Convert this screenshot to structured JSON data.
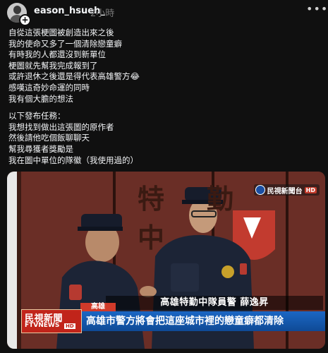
{
  "post": {
    "username": "eason_hsueh_",
    "timestamp": "2小時",
    "more_icon": "ellipsis-icon",
    "caption_lines_1": [
      "自從這張梗圖被創造出來之後",
      "我的使命又多了一個清除戀童癖",
      "有時我的人都還沒到新單位",
      "梗圖就先幫我完成報到了",
      "或許退休之後還是得代表高雄警方😂",
      "感嘆這奇妙命運的同時",
      "我有個大膽的想法"
    ],
    "caption_lines_2": [
      "以下發布任務：",
      "我想找到做出這張圖的原作者",
      "然後請他吃個飯聊聊天",
      "幫我尋獲者獎勵是",
      "我在圖中單位的隊徽（我使用過的）"
    ]
  },
  "media": {
    "station_wall_text": "特勤中",
    "channel_logo": "民視新聞台",
    "channel_hd": "HD",
    "program_logo_name": "民視新聞",
    "program_logo_sub": "FTVNEWS",
    "program_logo_hd": "HD",
    "location_tag": "高雄",
    "name_caption": "高雄特勤中隊員警  薛逸昇",
    "headline": "高雄市警方將會把這座城市裡的戀童癖都清除"
  }
}
